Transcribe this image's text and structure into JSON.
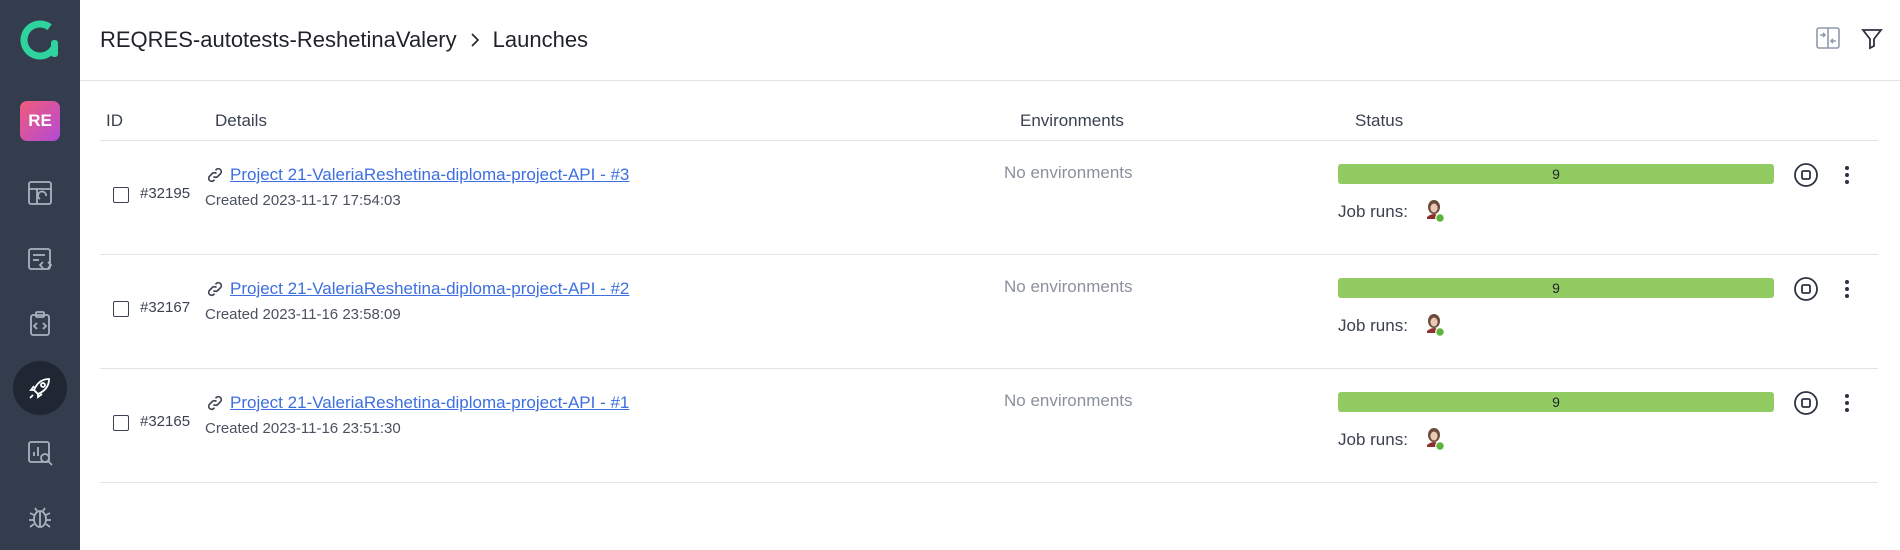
{
  "sidebar": {
    "avatar_initials": "RE",
    "items": [
      {
        "name": "dashboards-icon"
      },
      {
        "name": "test-cases-icon"
      },
      {
        "name": "test-plans-icon"
      },
      {
        "name": "launches-icon",
        "active": true
      },
      {
        "name": "analytics-icon"
      },
      {
        "name": "defects-icon"
      }
    ]
  },
  "header": {
    "project": "REQRES-autotests-ReshetinaValery",
    "separator_icon": "chevron-right-icon",
    "page": "Launches",
    "actions": [
      "compare-icon",
      "filter-icon",
      "upload-icon"
    ]
  },
  "table": {
    "columns": {
      "id": "ID",
      "details": "Details",
      "environments": "Environments",
      "status": "Status"
    },
    "rows": [
      {
        "id": "#32195",
        "name": "Project 21-ValeriaReshetina-diploma-project-API - #3",
        "created": "Created 2023-11-17 17:54:03",
        "env": "No environments",
        "passed": 9,
        "total": 9,
        "jobs_label": "Job runs:"
      },
      {
        "id": "#32167",
        "name": "Project 21-ValeriaReshetina-diploma-project-API - #2",
        "created": "Created 2023-11-16 23:58:09",
        "env": "No environments",
        "passed": 9,
        "total": 9,
        "jobs_label": "Job runs:"
      },
      {
        "id": "#32165",
        "name": "Project 21-ValeriaReshetina-diploma-project-API - #1",
        "created": "Created 2023-11-16 23:51:30",
        "env": "No environments",
        "passed": 9,
        "total": 9,
        "jobs_label": "Job runs:"
      }
    ]
  },
  "colors": {
    "sidebar": "#343d4d",
    "accent": "#3d6fe0",
    "passed": "#93cb63",
    "job_success": "#5fb33a"
  }
}
